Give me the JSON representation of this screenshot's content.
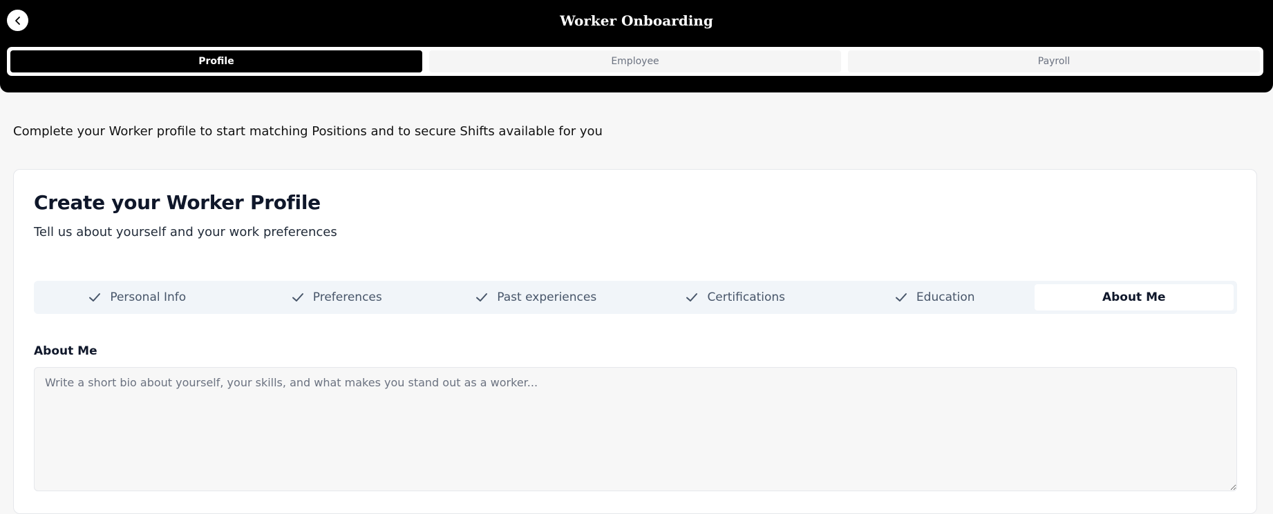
{
  "header": {
    "title": "Worker Onboarding",
    "back_icon": "chevron-left-icon"
  },
  "main_steps": [
    {
      "label": "Profile",
      "active": true
    },
    {
      "label": "Employee",
      "active": false
    },
    {
      "label": "Payroll",
      "active": false
    }
  ],
  "intro_text": "Complete your Worker profile to start matching Positions and to secure Shifts available for you",
  "card": {
    "title": "Create your Worker Profile",
    "subtitle": "Tell us about yourself and your work preferences"
  },
  "profile_tabs": [
    {
      "label": "Personal Info",
      "completed": true,
      "icon": "check-icon"
    },
    {
      "label": "Preferences",
      "completed": true,
      "icon": "check-icon"
    },
    {
      "label": "Past experiences",
      "completed": true,
      "icon": "check-icon"
    },
    {
      "label": "Certifications",
      "completed": true,
      "icon": "check-icon"
    },
    {
      "label": "Education",
      "completed": true,
      "icon": "check-icon"
    },
    {
      "label": "About Me",
      "completed": false,
      "active": true
    }
  ],
  "about_me": {
    "label": "About Me",
    "value": "",
    "placeholder": "Write a short bio about yourself, your skills, and what makes you stand out as a worker..."
  },
  "colors": {
    "header_bg": "#000000",
    "active_step_bg": "#000000",
    "page_bg": "#f7f7f7",
    "tabs_bg": "#f1f5f9"
  }
}
